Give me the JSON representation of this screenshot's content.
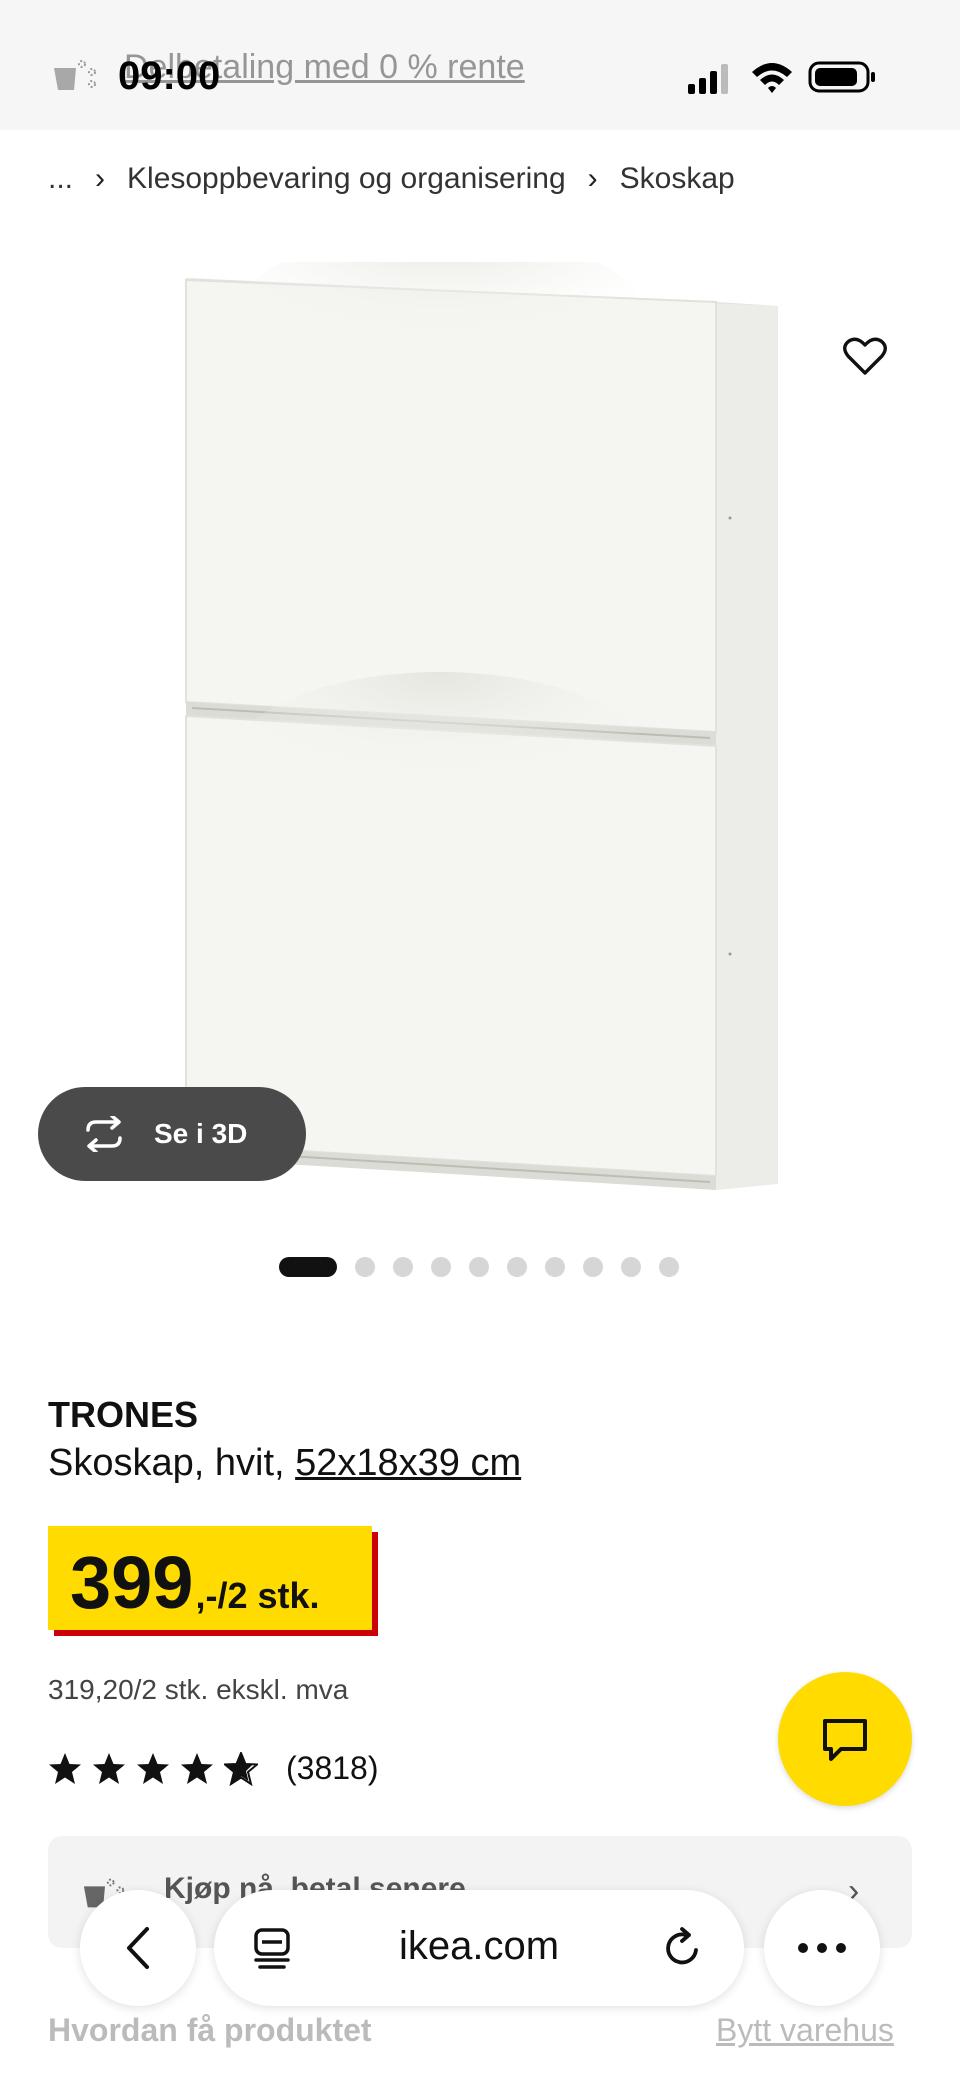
{
  "status_bar": {
    "time": "09:00",
    "banner_text": "Delbetaling med 0 % rente"
  },
  "breadcrumb": {
    "ellipsis": "...",
    "separator": "›",
    "items": [
      {
        "label": "Klesoppbevaring og organisering"
      },
      {
        "label": "Skoskap"
      }
    ]
  },
  "product": {
    "view_3d_label": "Se i 3D",
    "carousel": {
      "total": 10,
      "active": 1
    },
    "name": "TRONES",
    "description_prefix": "Skoskap, hvit, ",
    "dimensions": "52x18x39 cm",
    "price_main": "399",
    "price_suffix": ",-/2 stk.",
    "price_excl_vat": "319,20/2 stk. ekskl. mva",
    "rating_value": 4.5,
    "rating_count": "(3818)",
    "colors": {
      "price_bg": "#ffdb00",
      "price_shadow": "#cc0008"
    }
  },
  "pay_later": {
    "label": "Kjøp nå, betal senere"
  },
  "delivery": {
    "title": "Hvordan få produktet",
    "change_store": "Bytt varehus"
  },
  "browser": {
    "domain": "ikea.com"
  },
  "icons": {
    "wishlist": "heart-icon",
    "view_3d": "rotate-icon",
    "chat": "chat-icon",
    "back": "chevron-left-icon",
    "tabs": "tabs-icon",
    "reload": "reload-icon",
    "more": "more-icon"
  }
}
